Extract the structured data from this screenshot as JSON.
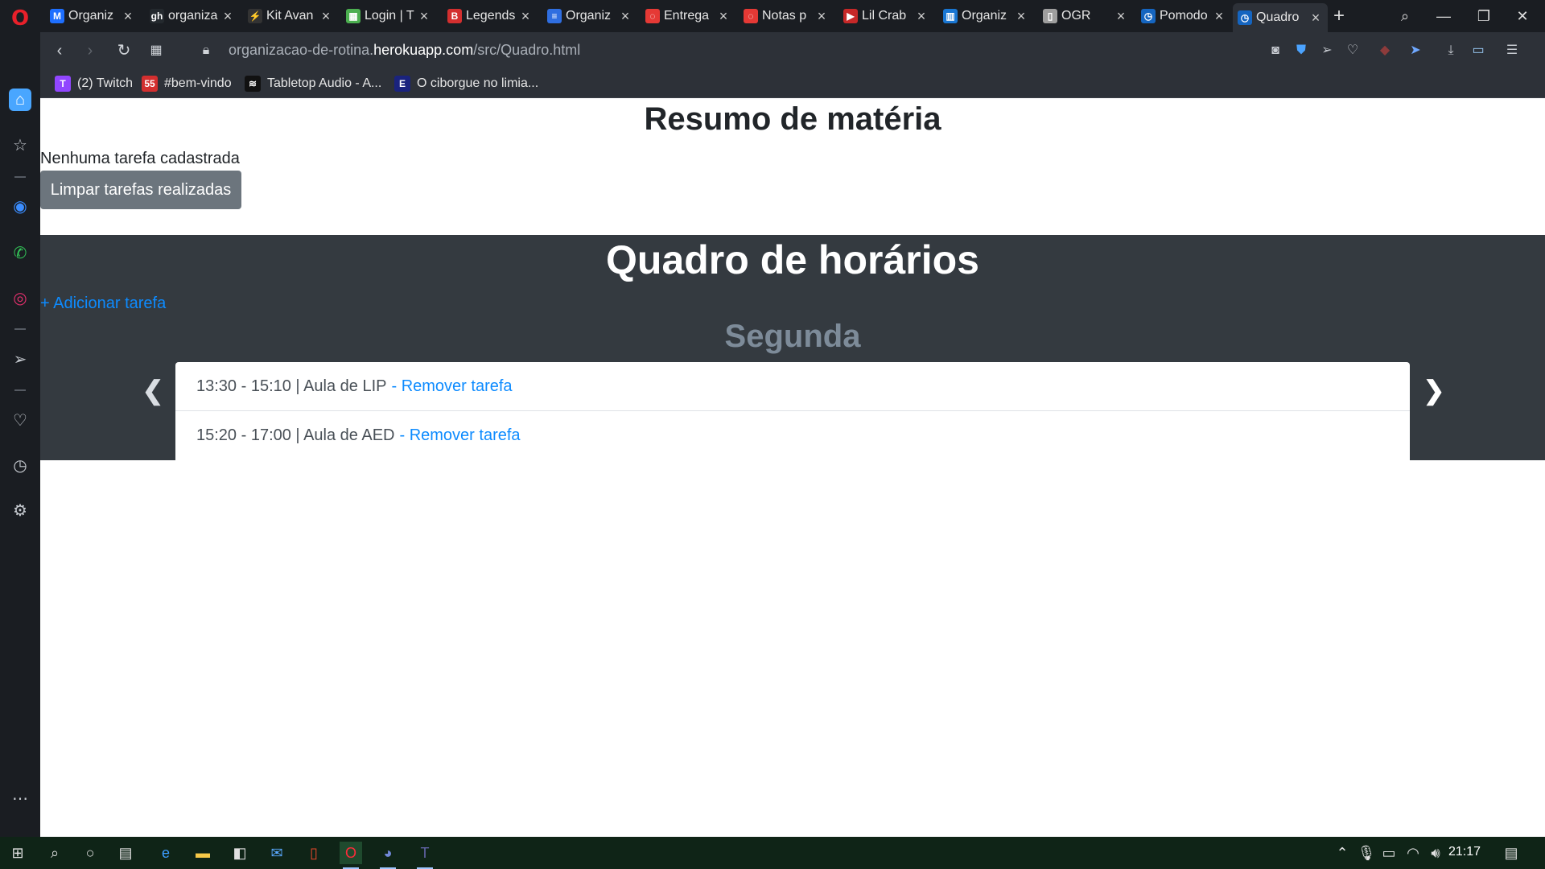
{
  "browser": {
    "tabs": [
      {
        "label": "Organiz",
        "favicon": "M",
        "color": "#1e6fff"
      },
      {
        "label": "organiza",
        "favicon": "gh",
        "color": "#24292e"
      },
      {
        "label": "Kit Avan",
        "favicon": "⚡",
        "color": "#333333"
      },
      {
        "label": "Login | T",
        "favicon": "▦",
        "color": "#4caf50"
      },
      {
        "label": "Legends",
        "favicon": "B",
        "color": "#d32f2f"
      },
      {
        "label": "Organiz",
        "favicon": "≡",
        "color": "#2f6ee0"
      },
      {
        "label": "Entrega",
        "favicon": "◌",
        "color": "#e53935"
      },
      {
        "label": "Notas p",
        "favicon": "◌",
        "color": "#e53935"
      },
      {
        "label": "Lil Crab",
        "favicon": "▶",
        "color": "#c62828"
      },
      {
        "label": "Organiz",
        "favicon": "▥",
        "color": "#1976d2"
      },
      {
        "label": "OGR",
        "favicon": "▯",
        "color": "#9e9e9e"
      },
      {
        "label": "Pomodo",
        "favicon": "◷",
        "color": "#1565c0"
      },
      {
        "label": "Quadro",
        "favicon": "◷",
        "color": "#1565c0"
      }
    ],
    "url_prefix": "organizacao-de-rotina.",
    "url_host": "herokuapp.com",
    "url_path": "/src/Quadro.html",
    "bookmarks": [
      {
        "label": "(2) Twitch",
        "icon": "T",
        "color": "#9146ff"
      },
      {
        "label": "#bem-vindo",
        "icon": "55",
        "color": "#d32f2f"
      },
      {
        "label": "Tabletop Audio - A...",
        "icon": "≋",
        "color": "#111111"
      },
      {
        "label": "O ciborgue no limia...",
        "icon": "E",
        "color": "#1a237e"
      }
    ]
  },
  "resumo": {
    "title": "Resumo de matéria",
    "empty_message": "Nenhuma tarefa cadastrada",
    "clear_button": "Limpar tarefas realizadas"
  },
  "quadro": {
    "title": "Quadro de horários",
    "add_link": "+ Adicionar tarefa",
    "day": "Segunda",
    "tasks": [
      {
        "text": "13:30 - 15:10 | Aula de LIP",
        "remove": "- Remover tarefa"
      },
      {
        "text": "15:20 - 17:00 | Aula de AED",
        "remove": "- Remover tarefa"
      }
    ]
  },
  "taskbar": {
    "time": "21:17"
  }
}
